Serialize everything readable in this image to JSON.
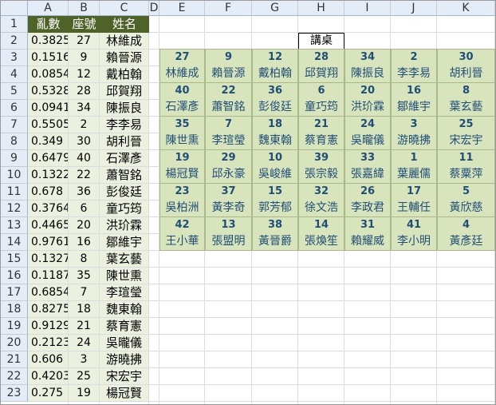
{
  "columns": [
    "A",
    "B",
    "C",
    "D",
    "E",
    "F",
    "G",
    "H",
    "I",
    "J",
    "K"
  ],
  "rows": [
    "1",
    "2",
    "3",
    "4",
    "5",
    "6",
    "7",
    "8",
    "9",
    "10",
    "11",
    "12",
    "13",
    "14",
    "15",
    "16",
    "17",
    "18",
    "19",
    "20",
    "21",
    "22",
    "23"
  ],
  "table": {
    "headers": [
      "亂數",
      "座號",
      "姓名"
    ],
    "data": [
      [
        "0.3825",
        "27",
        "林維成"
      ],
      [
        "0.1516",
        "9",
        "賴晉源"
      ],
      [
        "0.0854",
        "12",
        "戴柏翰"
      ],
      [
        "0.5328",
        "28",
        "邱賀翔"
      ],
      [
        "0.0941",
        "34",
        "陳振良"
      ],
      [
        "0.5505",
        "2",
        "李李易"
      ],
      [
        "0.349",
        "30",
        "胡利晉"
      ],
      [
        "0.6479",
        "40",
        "石澤彥"
      ],
      [
        "0.1322",
        "22",
        "蕭智銘"
      ],
      [
        "0.678",
        "36",
        "彭俊廷"
      ],
      [
        "0.3764",
        "6",
        "童巧筠"
      ],
      [
        "0.4465",
        "20",
        "洪玠霖"
      ],
      [
        "0.9761",
        "16",
        "鄒維宇"
      ],
      [
        "0.1327",
        "8",
        "葉玄藝"
      ],
      [
        "0.1187",
        "35",
        "陳世熏"
      ],
      [
        "0.6854",
        "7",
        "李瑄瑩"
      ],
      [
        "0.8275",
        "18",
        "魏東翰"
      ],
      [
        "0.9129",
        "21",
        "蔡育憲"
      ],
      [
        "0.2123",
        "24",
        "吳曨儀"
      ],
      [
        "0.606",
        "3",
        "游曉拂"
      ],
      [
        "0.4203",
        "25",
        "宋宏宇"
      ],
      [
        "0.275",
        "19",
        "楊冠賢"
      ]
    ]
  },
  "podium_label": "講桌",
  "seating": [
    [
      [
        "27",
        "林維成"
      ],
      [
        "9",
        "賴晉源"
      ],
      [
        "12",
        "戴柏翰"
      ],
      [
        "28",
        "邱賀翔"
      ],
      [
        "34",
        "陳振良"
      ],
      [
        "2",
        "李李易"
      ],
      [
        "30",
        "胡利晉"
      ]
    ],
    [
      [
        "40",
        "石澤彥"
      ],
      [
        "22",
        "蕭智銘"
      ],
      [
        "36",
        "彭俊廷"
      ],
      [
        "6",
        "童巧筠"
      ],
      [
        "20",
        "洪玠霖"
      ],
      [
        "16",
        "鄒維宇"
      ],
      [
        "8",
        "葉玄藝"
      ]
    ],
    [
      [
        "35",
        "陳世熏"
      ],
      [
        "7",
        "李瑄瑩"
      ],
      [
        "18",
        "魏東翰"
      ],
      [
        "21",
        "蔡育憲"
      ],
      [
        "24",
        "吳曨儀"
      ],
      [
        "3",
        "游曉拂"
      ],
      [
        "25",
        "宋宏宇"
      ]
    ],
    [
      [
        "19",
        "楊冠賢"
      ],
      [
        "29",
        "邱永豪"
      ],
      [
        "10",
        "吳峻維"
      ],
      [
        "39",
        "張宗毅"
      ],
      [
        "33",
        "張嘉緯"
      ],
      [
        "1",
        "葉麗儒"
      ],
      [
        "11",
        "蔡粟萍"
      ]
    ],
    [
      [
        "23",
        "吳柏洲"
      ],
      [
        "37",
        "黃李奇"
      ],
      [
        "15",
        "郭芳郁"
      ],
      [
        "32",
        "徐文浩"
      ],
      [
        "26",
        "李政君"
      ],
      [
        "17",
        "王輔任"
      ],
      [
        "5",
        "黃欣慈"
      ]
    ],
    [
      [
        "42",
        "王小華"
      ],
      [
        "13",
        "張盟明"
      ],
      [
        "38",
        "黃晉爵"
      ],
      [
        "14",
        "張煥笙"
      ],
      [
        "31",
        "賴耀威"
      ],
      [
        "41",
        "李小明"
      ],
      [
        "4",
        "黃彥廷"
      ]
    ]
  ],
  "colors": {
    "header_bg": "#4f6228",
    "data_bg": "#ebf1de",
    "seat_bg": "#d8e4bc",
    "seat_text": "#1f4e79"
  }
}
